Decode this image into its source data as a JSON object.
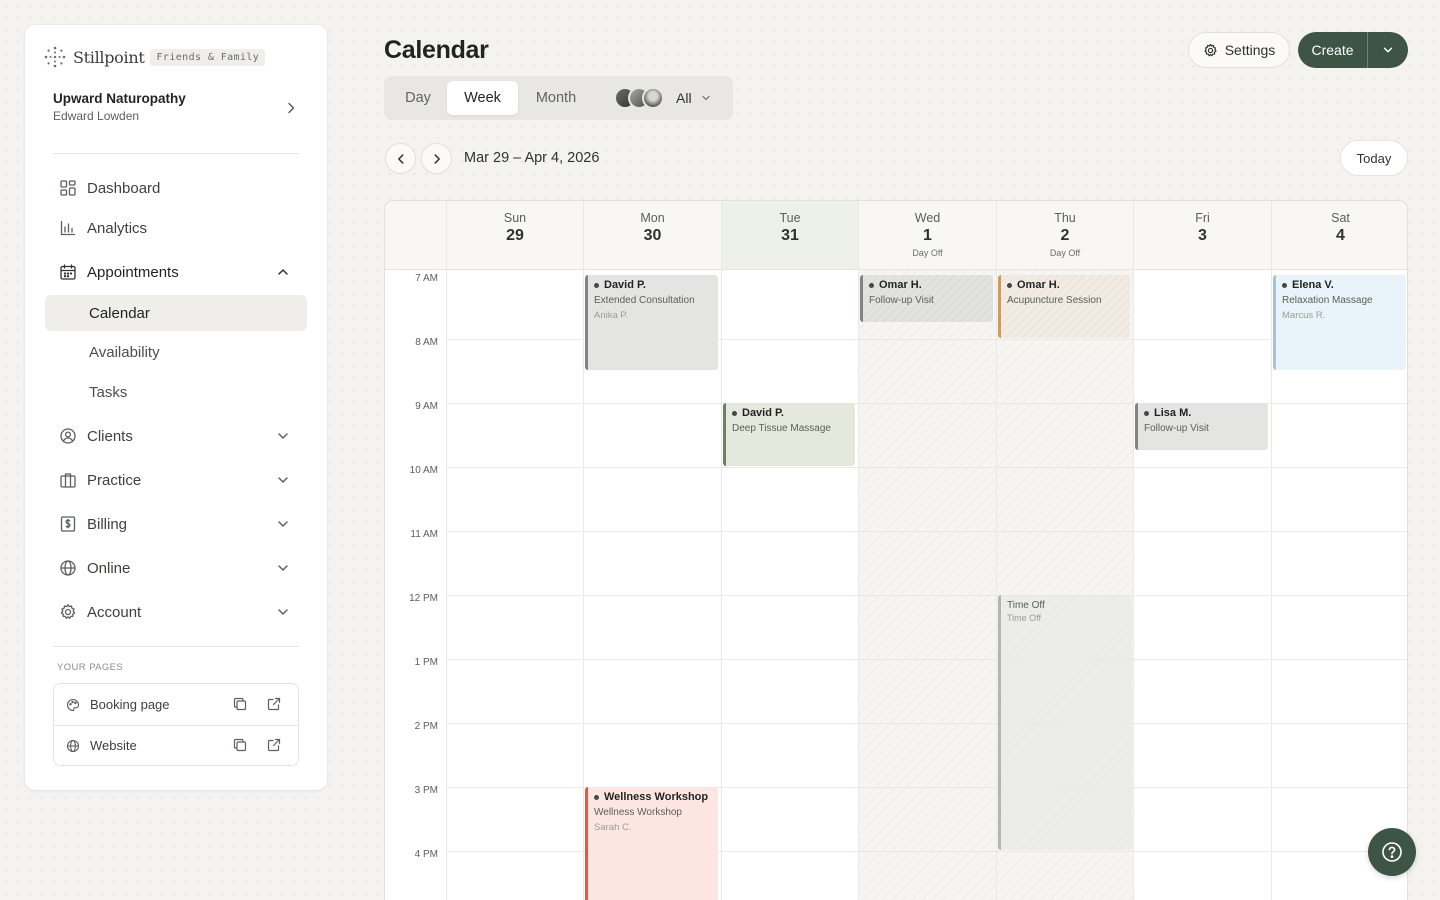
{
  "brand": {
    "name": "Stillpoint",
    "badge": "Friends & Family"
  },
  "practice": {
    "name": "Upward Naturopathy",
    "user": "Edward Lowden"
  },
  "nav": {
    "dashboard": "Dashboard",
    "analytics": "Analytics",
    "appointments": "Appointments",
    "calendar": "Calendar",
    "availability": "Availability",
    "tasks": "Tasks",
    "clients": "Clients",
    "practice": "Practice",
    "billing": "Billing",
    "online": "Online",
    "account": "Account"
  },
  "your_pages": {
    "title": "YOUR PAGES",
    "booking": "Booking page",
    "website": "Website"
  },
  "header": {
    "title": "Calendar",
    "settings": "Settings",
    "create": "Create"
  },
  "views": {
    "day": "Day",
    "week": "Week",
    "month": "Month",
    "staff": "All",
    "selected": "Week"
  },
  "date_range": "Mar 29 – Apr 4, 2026",
  "today_label": "Today",
  "days": [
    {
      "name": "Sun",
      "num": "29",
      "note": ""
    },
    {
      "name": "Mon",
      "num": "30",
      "note": ""
    },
    {
      "name": "Tue",
      "num": "31",
      "note": ""
    },
    {
      "name": "Wed",
      "num": "1",
      "note": "Day Off"
    },
    {
      "name": "Thu",
      "num": "2",
      "note": "Day Off"
    },
    {
      "name": "Fri",
      "num": "3",
      "note": ""
    },
    {
      "name": "Sat",
      "num": "4",
      "note": ""
    }
  ],
  "hours": [
    "7 AM",
    "8 AM",
    "9 AM",
    "10 AM",
    "11 AM",
    "12 PM",
    "1 PM",
    "2 PM",
    "3 PM",
    "4 PM"
  ],
  "events": {
    "mon1": {
      "title": "David P.",
      "service": "Extended Consultation",
      "staff": "Anika P."
    },
    "mon2": {
      "title": "Wellness Workshop",
      "service": "Wellness Workshop",
      "staff": "Sarah C."
    },
    "tue1": {
      "title": "David P.",
      "service": "Deep Tissue Massage"
    },
    "wed1": {
      "title": "Omar H.",
      "service": "Follow-up Visit"
    },
    "thu1": {
      "title": "Omar H.",
      "service": "Acupuncture Session"
    },
    "thu2": {
      "title": "Time Off",
      "service": "Time Off"
    },
    "fri1": {
      "title": "Lisa M.",
      "service": "Follow-up Visit"
    },
    "sat1": {
      "title": "Elena V.",
      "service": "Relaxation Massage",
      "staff": "Marcus R."
    }
  },
  "colors": {
    "brand": "#3e5445",
    "mon1": "#7f857f",
    "mon2": "#e05a4a",
    "tue1": "#6f7e66",
    "thu1": "#cf9a5c",
    "sat1": "#a7c4d3"
  },
  "icons": {
    "nav": [
      "dashboard-icon",
      "analytics-icon",
      "calendar-icon",
      "clients-icon",
      "practice-icon",
      "billing-icon",
      "online-icon",
      "account-icon"
    ],
    "actions": [
      "gear-icon",
      "chevron-down-icon",
      "chevron-left-icon",
      "chevron-right-icon",
      "copy-icon",
      "external-link-icon",
      "help-icon"
    ]
  }
}
